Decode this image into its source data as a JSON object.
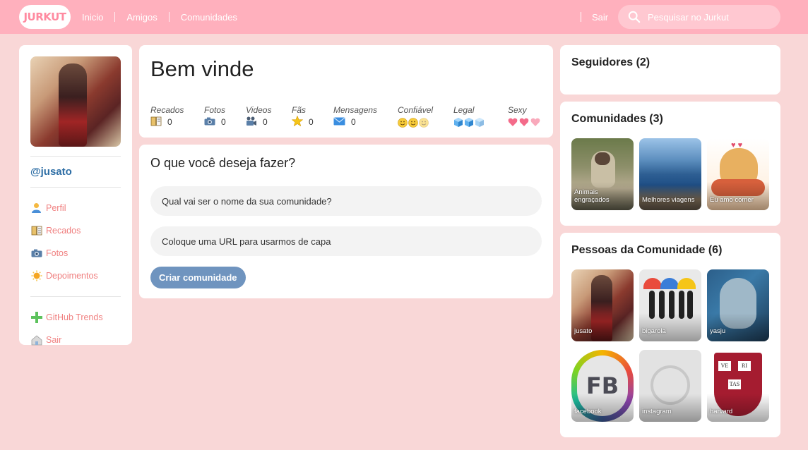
{
  "header": {
    "logo": "JURKUT",
    "nav": [
      "Inicio",
      "Amigos",
      "Comunidades"
    ],
    "logout": "Sair",
    "search_placeholder": "Pesquisar no Jurkut",
    "colors": {
      "bar": "#ffb0bd",
      "background": "#f9d7d7"
    }
  },
  "profile": {
    "username": "@jusato",
    "menu": [
      {
        "label": "Perfil",
        "icon": "user-icon"
      },
      {
        "label": "Recados",
        "icon": "book-icon"
      },
      {
        "label": "Fotos",
        "icon": "camera-icon"
      },
      {
        "label": "Depoimentos",
        "icon": "sun-icon"
      }
    ],
    "menu2": [
      {
        "label": "GitHub Trends",
        "icon": "plus-icon"
      },
      {
        "label": "Sair",
        "icon": "logout-icon"
      }
    ]
  },
  "welcome": {
    "title": "Bem vinde",
    "stats": [
      {
        "label": "Recados",
        "value": "0",
        "icon": "book-icon"
      },
      {
        "label": "Fotos",
        "value": "0",
        "icon": "camera-icon"
      },
      {
        "label": "Videos",
        "value": "0",
        "icon": "video-camera-icon"
      },
      {
        "label": "Fãs",
        "value": "0",
        "icon": "star-icon"
      },
      {
        "label": "Mensagens",
        "value": "0",
        "icon": "envelope-icon"
      }
    ],
    "ratings": [
      {
        "label": "Confiável",
        "icon": "smiley-icon",
        "count": 3
      },
      {
        "label": "Legal",
        "icon": "ice-cube-icon",
        "count": 3
      },
      {
        "label": "Sexy",
        "icon": "heart-icon",
        "count": 3
      }
    ]
  },
  "create": {
    "title": "O que você deseja fazer?",
    "name_placeholder": "Qual vai ser o nome da sua comunidade?",
    "url_placeholder": "Coloque uma URL para usarmos de capa",
    "button": "Criar comunidade",
    "button_color": "#6f94bf"
  },
  "followers": {
    "title": "Seguidores (2)"
  },
  "communities": {
    "title": "Comunidades (3)",
    "items": [
      "Animais engraçados",
      "Melhores viagens",
      "Eu amo comer"
    ]
  },
  "people": {
    "title": "Pessoas da Comunidade (6)",
    "items": [
      "jusato",
      "bigarola",
      "yasju",
      "facebook",
      "instagram",
      "harvard"
    ]
  }
}
